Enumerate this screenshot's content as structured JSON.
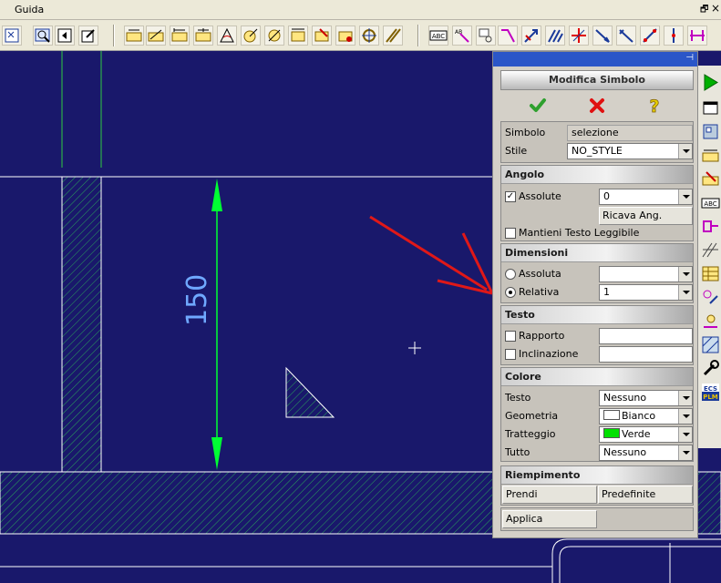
{
  "menubar": {
    "guida_label": "Guida",
    "restore_glyph": "🗗",
    "close_glyph": "×"
  },
  "canvas": {
    "dimension_value": "150",
    "colors": {
      "background": "#19186b",
      "line": "#ffffff",
      "dimension": "#00ff33",
      "hatch": "#2aa35a"
    }
  },
  "dock": {
    "pin_glyph": "⊣"
  },
  "panel": {
    "title": "Modifica Simbolo",
    "simbolo": {
      "label": "Simbolo",
      "value": "selezione"
    },
    "stile": {
      "label": "Stile",
      "value": "NO_STYLE"
    },
    "angolo": {
      "heading": "Angolo",
      "assolute_label": "Assolute",
      "assolute_checked": true,
      "value": "0",
      "ricava_button": "Ricava Ang.",
      "mantieni_label": "Mantieni Testo Leggibile",
      "mantieni_checked": false
    },
    "dimensioni": {
      "heading": "Dimensioni",
      "assoluta_label": "Assoluta",
      "assoluta_value": "",
      "relativa_label": "Relativa",
      "relativa_value": "1",
      "selected": "Relativa"
    },
    "testo": {
      "heading": "Testo",
      "rapporto_label": "Rapporto",
      "rapporto_value": "",
      "inclinazione_label": "Inclinazione",
      "inclinazione_value": ""
    },
    "colore": {
      "heading": "Colore",
      "testo_label": "Testo",
      "testo_value": "Nessuno",
      "geometria_label": "Geometria",
      "geometria_value": "Bianco",
      "geometria_color": "#ffffff",
      "tratteggio_label": "Tratteggio",
      "tratteggio_value": "Verde",
      "tratteggio_color": "#00e000",
      "tutto_label": "Tutto",
      "tutto_value": "Nessuno"
    },
    "riempimento": {
      "heading": "Riempimento",
      "prendi_button": "Prendi",
      "predefinite_button": "Predefinite"
    },
    "applica_button": "Applica"
  }
}
